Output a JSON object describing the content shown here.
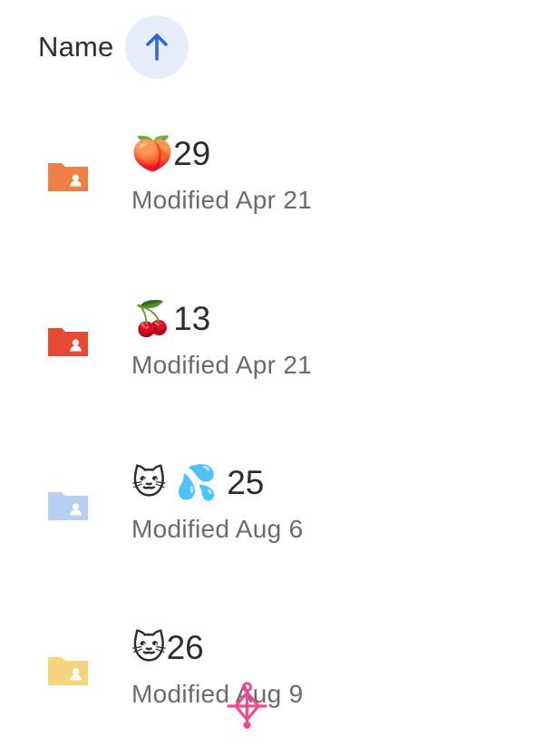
{
  "header": {
    "sort_label": "Name",
    "sort_direction": "ascending",
    "sort_icon": "arrow-up-icon",
    "accent_color": "#2f67d8",
    "button_bg": "#e6edfa"
  },
  "files": [
    {
      "name": "🍑29",
      "meta": "Modified Apr 21",
      "icon": "shared-folder-icon",
      "folder_color": "#f07f45"
    },
    {
      "name": "🍒13",
      "meta": "Modified Apr 21",
      "icon": "shared-folder-icon",
      "folder_color": "#e64a35"
    },
    {
      "name": "🐱 💦 25",
      "meta": "Modified Aug 6",
      "icon": "shared-folder-icon",
      "folder_color": "#b7cff0"
    },
    {
      "name": "🐱26",
      "meta": "Modified Aug 9",
      "icon": "shared-folder-icon",
      "folder_color": "#f5d57b"
    }
  ],
  "overlay": {
    "icon": "pink-cursor-marker-icon",
    "color": "#ef4a8f"
  }
}
